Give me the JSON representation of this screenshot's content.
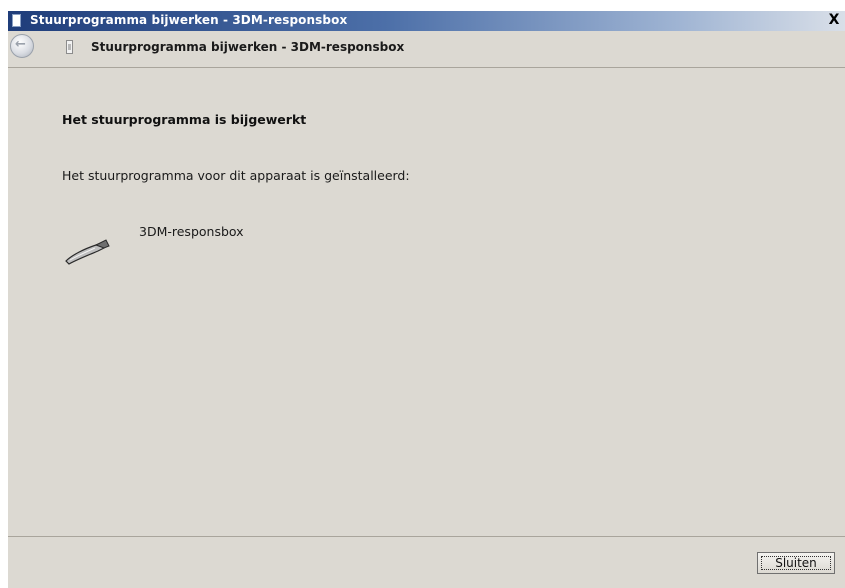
{
  "window": {
    "title": "Stuurprogramma bijwerken - 3DM-responsbox",
    "close_glyph": "X"
  },
  "nav": {
    "back_glyph": "←",
    "title": "Stuurprogramma bijwerken - 3DM-responsbox"
  },
  "content": {
    "heading": "Het stuurprogramma is bijgewerkt",
    "description": "Het stuurprogramma voor dit apparaat is geïnstalleerd:",
    "device_name": "3DM-responsbox",
    "device_icon": "usb-device-icon"
  },
  "footer": {
    "close_button_label": "Sluiten"
  },
  "colors": {
    "titlebar_start": "#1f3d7a",
    "dialog_background": "#dcd9d2"
  }
}
